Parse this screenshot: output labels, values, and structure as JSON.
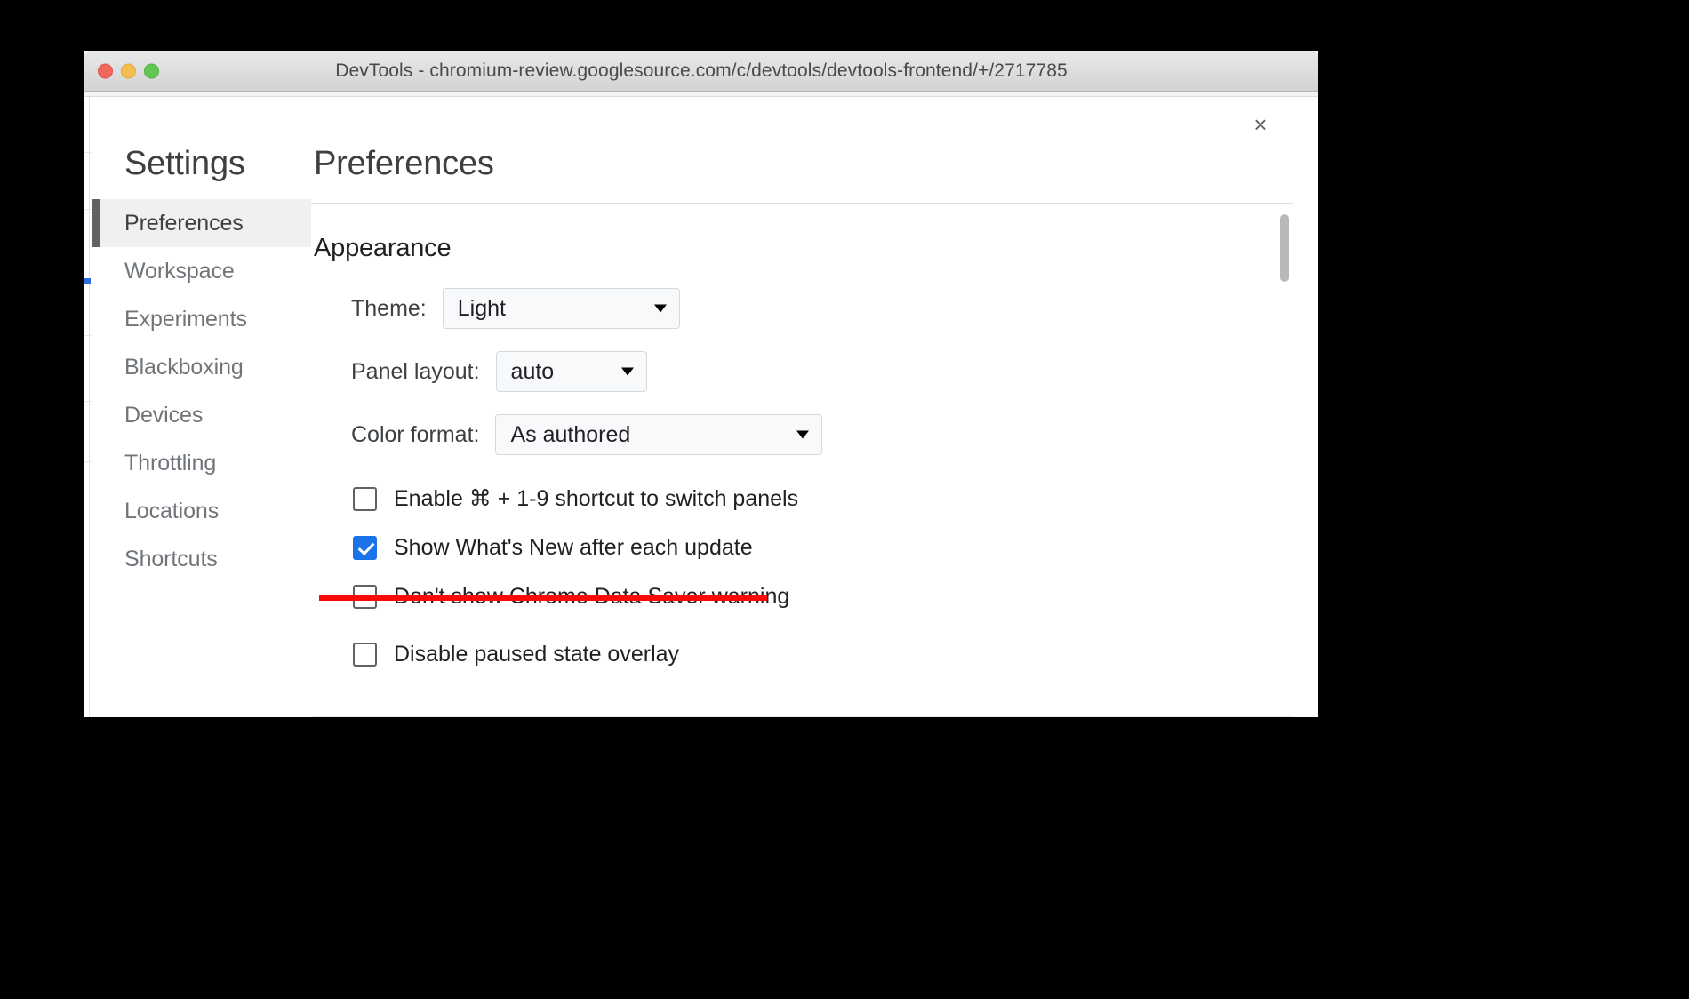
{
  "window": {
    "title": "DevTools - chromium-review.googlesource.com/c/devtools/devtools-frontend/+/2717785",
    "traffic_lights": [
      "close",
      "minimize",
      "zoom"
    ]
  },
  "dialog": {
    "close_label": "×",
    "sidebar": {
      "title": "Settings",
      "items": [
        {
          "label": "Preferences",
          "selected": true
        },
        {
          "label": "Workspace",
          "selected": false
        },
        {
          "label": "Experiments",
          "selected": false
        },
        {
          "label": "Blackboxing",
          "selected": false
        },
        {
          "label": "Devices",
          "selected": false
        },
        {
          "label": "Throttling",
          "selected": false
        },
        {
          "label": "Locations",
          "selected": false
        },
        {
          "label": "Shortcuts",
          "selected": false
        }
      ]
    },
    "content": {
      "title": "Preferences",
      "section_title": "Appearance",
      "selects": [
        {
          "label": "Theme:",
          "value": "Light"
        },
        {
          "label": "Panel layout:",
          "value": "auto"
        },
        {
          "label": "Color format:",
          "value": "As authored"
        }
      ],
      "checkboxes": [
        {
          "label": "Enable ⌘ + 1-9 shortcut to switch panels",
          "checked": false,
          "annotated": false
        },
        {
          "label": "Show What's New after each update",
          "checked": true,
          "annotated": false
        },
        {
          "label": "Don't show Chrome Data Saver warning",
          "checked": false,
          "annotated": true
        },
        {
          "label": "Disable paused state overlay",
          "checked": false,
          "annotated": false
        }
      ]
    }
  },
  "colors": {
    "accent": "#1a73e8",
    "annotation_red": "#f60b06",
    "selected_nav_bg": "#f0f0f0",
    "selected_nav_bar": "#616161",
    "text_primary": "#202124",
    "text_secondary": "#70757a",
    "backdrop": "#000000"
  }
}
